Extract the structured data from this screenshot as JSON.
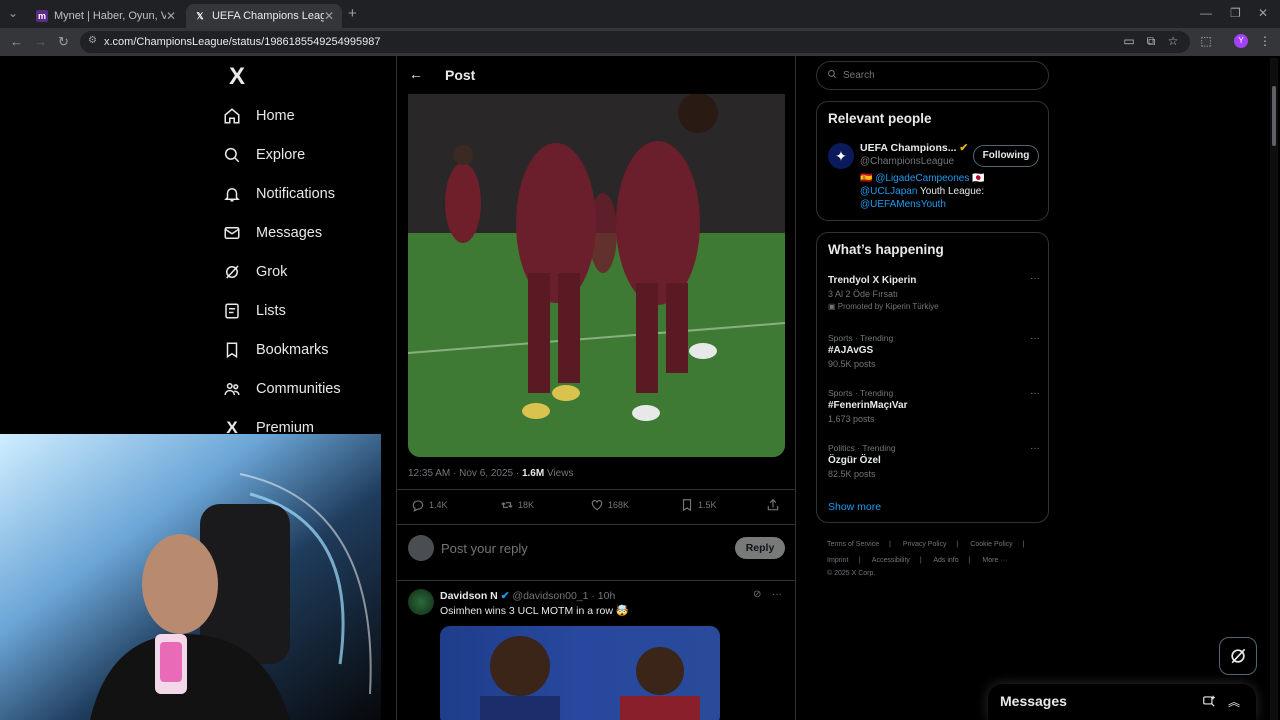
{
  "browser": {
    "tabs": [
      {
        "title": "Mynet | Haber, Oyun, Video, Sp",
        "active": false
      },
      {
        "title": "UEFA Champions League on X:",
        "active": true
      }
    ],
    "url": "x.com/ChampionsLeague/status/1986185549254995987",
    "profile_initial": "Y"
  },
  "sidebar": {
    "logo": "X",
    "items": [
      {
        "label": "Home",
        "icon": "home-icon"
      },
      {
        "label": "Explore",
        "icon": "search-icon"
      },
      {
        "label": "Notifications",
        "icon": "bell-icon"
      },
      {
        "label": "Messages",
        "icon": "envelope-icon"
      },
      {
        "label": "Grok",
        "icon": "grok-icon"
      },
      {
        "label": "Lists",
        "icon": "list-icon"
      },
      {
        "label": "Bookmarks",
        "icon": "bookmark-icon"
      },
      {
        "label": "Communities",
        "icon": "communities-icon"
      },
      {
        "label": "Premium",
        "icon": "x-premium-icon"
      }
    ]
  },
  "post": {
    "header_title": "Post",
    "timestamp": "12:35 AM · Nov 6, 2025 · ",
    "views_count": "1.6M",
    "views_label": " Views",
    "actions": {
      "replies": "1.4K",
      "reposts": "18K",
      "likes": "168K",
      "bookmarks": "1.5K"
    },
    "reply_placeholder": "Post your reply",
    "reply_button": "Reply"
  },
  "reply_tweet": {
    "name": "Davidson N",
    "handle": "@davidson00_1 · 10h",
    "text": "Osimhen wins 3 UCL MOTM in a row 🤯"
  },
  "right": {
    "search_placeholder": "Search",
    "relevant_title": "Relevant people",
    "person": {
      "name": "UEFA Champions...",
      "handle": "@ChampionsLeague",
      "follow_label": "Following",
      "bio_link1": "@LigadeCampeones",
      "bio_link2": "@UCLJapan",
      "bio_text": " Youth League:",
      "bio_link3": "@UEFAMensYouth"
    },
    "happening_title": "What’s happening",
    "trends": [
      {
        "meta": "",
        "title": "Trendyol X Kiperin",
        "sub": "3 Al 2 Öde Fırsatı",
        "extra": "Promoted by Kiperin Türkiye"
      },
      {
        "meta": "Sports · Trending",
        "title": "#AJAvGS",
        "sub": "90.5K posts",
        "extra": ""
      },
      {
        "meta": "Sports · Trending",
        "title": "#FenerinMaçıVar",
        "sub": "1,673 posts",
        "extra": ""
      },
      {
        "meta": "Politics · Trending",
        "title": "Özgür Özel",
        "sub": "82.5K posts",
        "extra": ""
      }
    ],
    "show_more": "Show more",
    "footer": {
      "line1": [
        "Terms of Service",
        "Privacy Policy",
        "Cookie Policy"
      ],
      "line2": [
        "Imprint",
        "Accessibility",
        "Ads info",
        "More ···"
      ],
      "copyright": "© 2025 X Corp."
    }
  },
  "messages_drawer": {
    "title": "Messages"
  },
  "colors": {
    "accent": "#1d9bf0",
    "background": "#000000",
    "border": "#2f3336"
  }
}
